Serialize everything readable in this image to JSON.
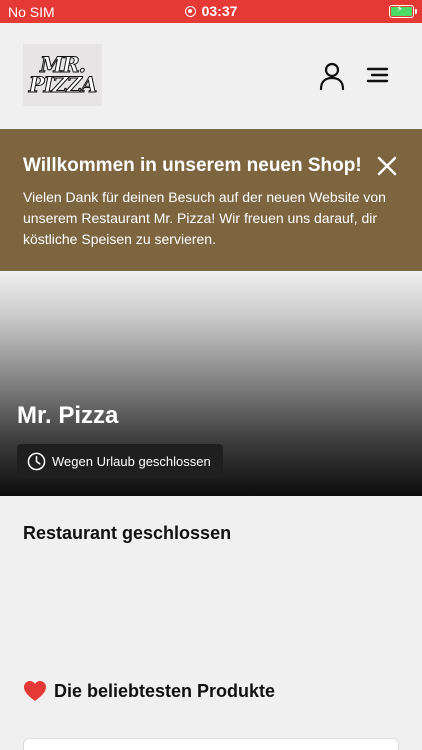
{
  "status_bar": {
    "carrier": "No SIM",
    "time": "03:37",
    "battery_color": "#4cd964"
  },
  "header": {
    "logo_line1": "MR.",
    "logo_line2": "PIZZA",
    "user_icon": "user-icon",
    "menu_icon": "menu-icon"
  },
  "banner": {
    "title": "Willkommen in unserem neuen Shop!",
    "text": "Vielen Dank für deinen Besuch auf der neuen Website von unserem Restaurant Mr. Pizza! Wir freuen uns darauf, dir köstliche Speisen zu servieren.",
    "background_color": "#7d6540",
    "close_icon": "close-icon"
  },
  "hero": {
    "restaurant_name": "Mr. Pizza",
    "status_text": "Wegen Urlaub geschlossen",
    "status_icon": "clock-icon"
  },
  "main": {
    "closed_heading": "Restaurant geschlossen",
    "popular_heading": "Die beliebtesten Produkte",
    "popular_icon": "heart-icon"
  },
  "colors": {
    "status_bar": "#e53935",
    "banner": "#7d6540",
    "heart": "#e53935"
  }
}
